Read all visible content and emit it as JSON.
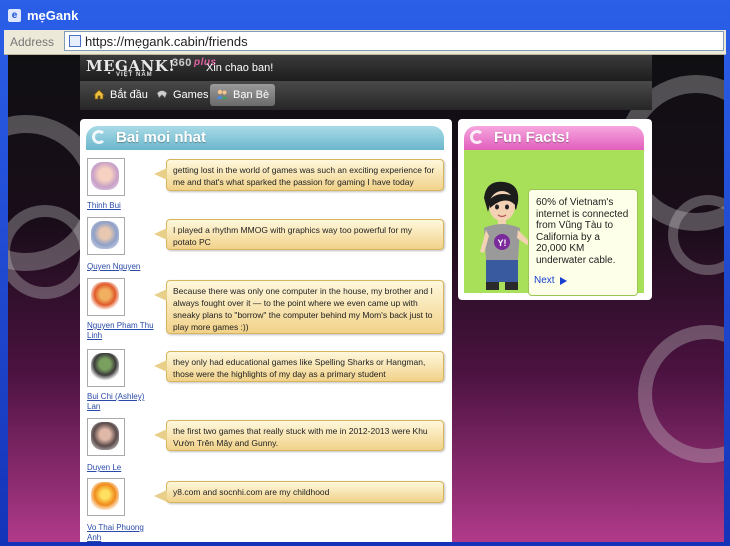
{
  "window": {
    "title": "mẹGank"
  },
  "address": {
    "label": "Address",
    "url": "https://mẹgank.cabin/friends"
  },
  "site": {
    "logo": "MẸGANK!",
    "logo_sub": "VIỆT NAM",
    "logo_num": "360",
    "logo_plus": "plus",
    "greeting": "Xin chao ban!"
  },
  "nav": {
    "tabs": [
      {
        "label": "Bắt đầu",
        "icon": "home-icon"
      },
      {
        "label": "Games",
        "icon": "gamepad-icon"
      },
      {
        "label": "Bạn Bè",
        "icon": "friends-icon",
        "active": true
      }
    ]
  },
  "posts_panel": {
    "title": "Bai moi nhat",
    "posts": [
      {
        "author": "Thinh Bui",
        "text": "getting lost in the world of games was such an exciting experience for me and that's what sparked the passion for gaming I have today"
      },
      {
        "author": "Quyen Nguyen",
        "text": "I played a rhythm MMOG with graphics way too powerful for my potato PC"
      },
      {
        "author": "Nguyen Pham Thu Linh",
        "text": "Because there was only one computer in the house, my brother and I always fought over it — to the point where we even came up with sneaky plans to \"borrow\" the computer behind my Mom's back just to play more games :))"
      },
      {
        "author": "Bui Chi (Ashley) Lan",
        "text": "they only had educational games like Spelling Sharks or Hangman, those were the highlights of my day as a primary student"
      },
      {
        "author": "Duyen Le",
        "text": "the first two games that really stuck with me in 2012-2013 were Khu Vườn Trên Mây and Gunny."
      },
      {
        "author": "Vo Thai Phuong Anh",
        "text": "y8.com and socnhi.com are my childhood"
      }
    ]
  },
  "fun_facts": {
    "title": "Fun Facts!",
    "text": "60% of Vietnam's internet is connected from Vũng Tàu to California by a 20,000 KM underwater cable.",
    "next_label": "Next",
    "shirt_logo": "Y!"
  },
  "colors": {
    "posts_header": "#7ec3d6",
    "fun_header": "#e97bc9",
    "fun_bg": "#a8e05a",
    "link": "#2a4aa8"
  }
}
